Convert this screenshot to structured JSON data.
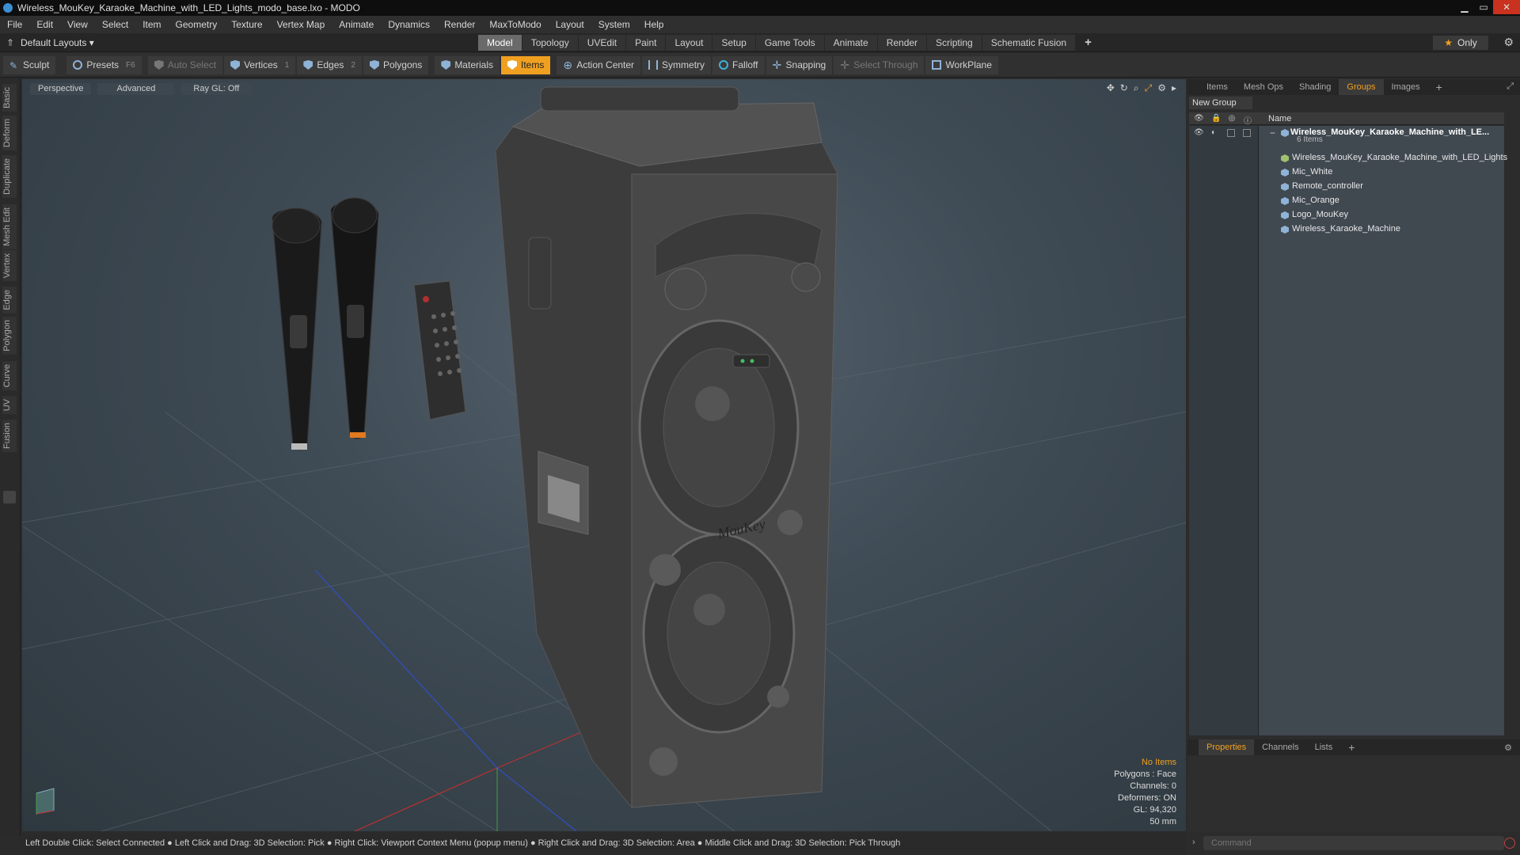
{
  "window": {
    "title": "Wireless_MouKey_Karaoke_Machine_with_LED_Lights_modo_base.lxo - MODO"
  },
  "menu": [
    "File",
    "Edit",
    "View",
    "Select",
    "Item",
    "Geometry",
    "Texture",
    "Vertex Map",
    "Animate",
    "Dynamics",
    "Render",
    "MaxToModo",
    "Layout",
    "System",
    "Help"
  ],
  "layouts": {
    "label": "Default Layouts"
  },
  "tabs": [
    "Model",
    "Topology",
    "UVEdit",
    "Paint",
    "Layout",
    "Setup",
    "Game Tools",
    "Animate",
    "Render",
    "Scripting",
    "Schematic Fusion"
  ],
  "active_tab": "Model",
  "only_label": "Only",
  "toolbar": {
    "sculpt": "Sculpt",
    "presets": "Presets",
    "presets_key": "F6",
    "auto_select": "Auto Select",
    "vertices": "Vertices",
    "vertices_num": "1",
    "edges": "Edges",
    "edges_num": "2",
    "polygons": "Polygons",
    "materials": "Materials",
    "items": "Items",
    "action_center": "Action Center",
    "symmetry": "Symmetry",
    "falloff": "Falloff",
    "snapping": "Snapping",
    "select_through": "Select Through",
    "workplane": "WorkPlane"
  },
  "left_tabs": [
    "Basic",
    "Deform",
    "Duplicate",
    "Mesh Edit",
    "Vertex",
    "Edge",
    "Polygon",
    "Curve",
    "UV",
    "Fusion"
  ],
  "viewport": {
    "perspective": "Perspective",
    "advanced": "Advanced",
    "raygl": "Ray GL: Off",
    "stats": {
      "no_items": "No Items",
      "polygons": "Polygons : Face",
      "channels": "Channels: 0",
      "deformers": "Deformers: ON",
      "gl": "GL: 94,320",
      "size": "50 mm"
    },
    "model_logo": "MouKey"
  },
  "status": "Left Double Click: Select Connected ● Left Click and Drag: 3D Selection: Pick ● Right Click: Viewport Context Menu (popup menu) ● Right Click and Drag: 3D Selection: Area ● Middle Click and Drag: 3D Selection: Pick Through",
  "right_panel": {
    "tabs": [
      "Items",
      "Mesh Ops",
      "Shading",
      "Groups",
      "Images"
    ],
    "active_tab": "Groups",
    "new_group": "New Group",
    "name_header": "Name",
    "group_name": "Wireless_MouKey_Karaoke_Machine_with_LE...",
    "group_count": "6 Items",
    "items": [
      "Wireless_MouKey_Karaoke_Machine_with_LED_Lights",
      "Mic_White",
      "Remote_controller",
      "Mic_Orange",
      "Logo_MouKey",
      "Wireless_Karaoke_Machine"
    ]
  },
  "props_tabs": [
    "Properties",
    "Channels",
    "Lists"
  ],
  "props_active": "Properties",
  "command_placeholder": "Command"
}
